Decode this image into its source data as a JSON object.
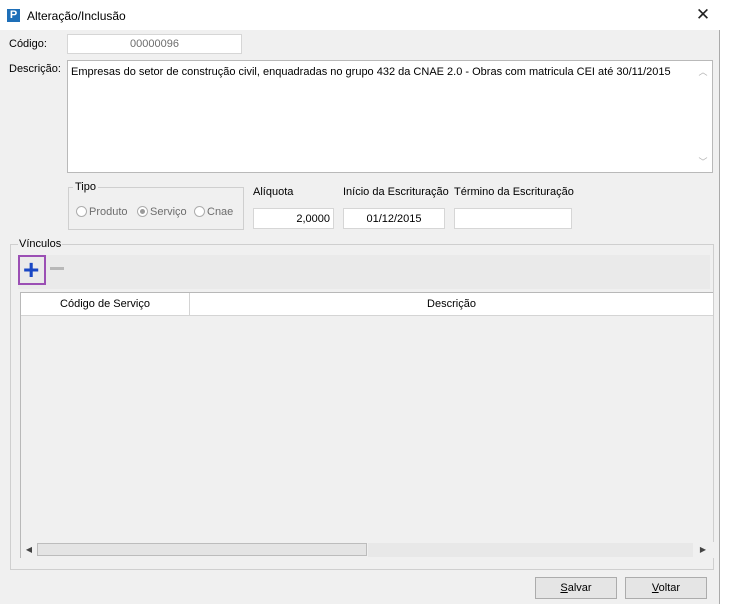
{
  "window": {
    "title": "Alteração/Inclusão",
    "close_glyph": "✕",
    "app_icon_letter": "P"
  },
  "form": {
    "codigo_label": "Código:",
    "codigo_value": "00000096",
    "descricao_label": "Descrição:",
    "descricao_value": "Empresas do setor de construção civil, enquadradas no grupo 432 da CNAE 2.0 - Obras com matricula CEI até 30/11/2015",
    "tipo_legend": "Tipo",
    "tipo_options": [
      "Produto",
      "Serviço",
      "Cnae"
    ],
    "tipo_selected": "Serviço",
    "aliquota_label": "Alíquota",
    "aliquota_value": "2,0000",
    "inicio_label": "Início da Escrituração",
    "inicio_value": "01/12/2015",
    "termino_label": "Término da Escrituração",
    "termino_value": ""
  },
  "vinculos": {
    "label": "Vínculos",
    "add_icon": "plus-icon",
    "remove_icon": "minus-icon",
    "columns": [
      "Código de Serviço",
      "Descrição"
    ],
    "rows": []
  },
  "buttons": {
    "salvar_first": "S",
    "salvar_rest": "alvar",
    "voltar_first": "V",
    "voltar_rest": "oltar"
  }
}
